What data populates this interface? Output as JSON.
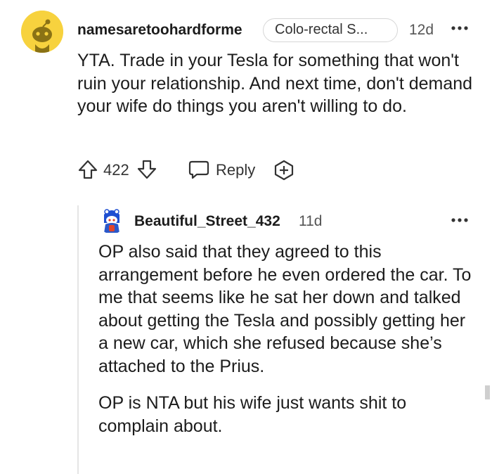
{
  "comment": {
    "username": "namesaretoohardforme",
    "flair": "Colo-rectal S...",
    "timestamp": "12d",
    "body": "YTA. Trade in your Tesla for something that won't ruin your relationship. And next time, don't demand your wife do things you aren't willing to do.",
    "score": "422",
    "reply_label": "Reply"
  },
  "reply": {
    "username": "Beautiful_Street_432",
    "timestamp": "11d",
    "paragraphs": [
      "OP also said that they agreed to this arrangement before he even ordered the car. To me that seems like he sat her down and talked about getting the Tesla and possibly getting her a new car, which she refused because she’s attached to the Prius.",
      "OP is NTA but his wife just wants shit to complain about."
    ]
  },
  "icons": {
    "upvote": "upvote-arrow-icon",
    "downvote": "downvote-arrow-icon",
    "reply": "speech-bubble-icon",
    "award": "award-plus-icon",
    "more": "more-dots-icon"
  },
  "colors": {
    "avatar_main_bg": "#f7d23e",
    "text": "#1c1c1c",
    "muted": "#555555"
  }
}
